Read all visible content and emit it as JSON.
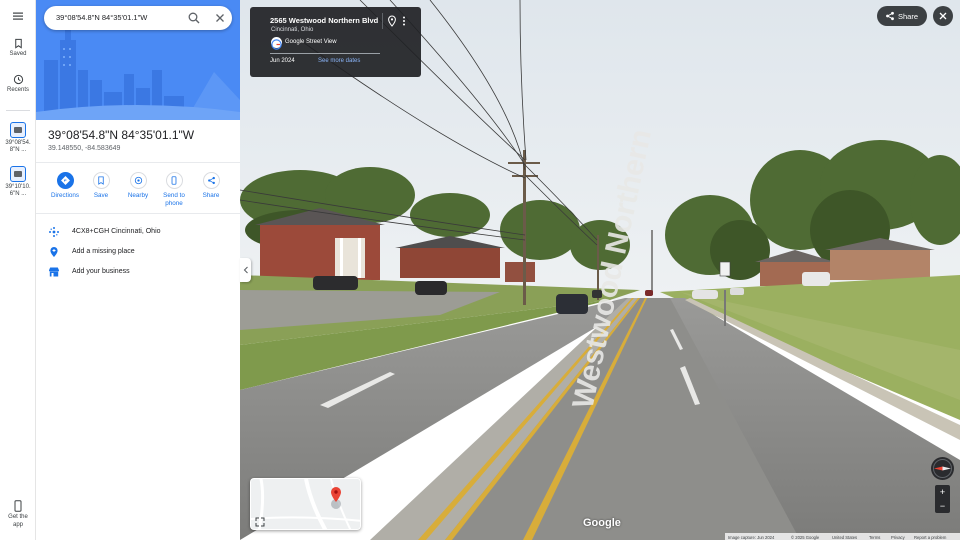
{
  "rail": {
    "saved_label": "Saved",
    "recents_label": "Recents",
    "recent_items": [
      {
        "label_line1": "39°08'54.",
        "label_line2": "8\"N ..."
      },
      {
        "label_line1": "39°10'10.",
        "label_line2": "6\"N ..."
      }
    ],
    "get_app_line1": "Get the",
    "get_app_line2": "app"
  },
  "search": {
    "value": "39°08'54.8\"N 84°35'01.1\"W"
  },
  "place": {
    "title": "39°08'54.8\"N 84°35'01.1\"W",
    "decimal_coords": "39.148550, -84.583649"
  },
  "actions": [
    {
      "label_line1": "Directions",
      "label_line2": "",
      "icon": "directions-icon"
    },
    {
      "label_line1": "Save",
      "label_line2": "",
      "icon": "bookmark-icon"
    },
    {
      "label_line1": "Nearby",
      "label_line2": "",
      "icon": "nearby-icon"
    },
    {
      "label_line1": "Send to",
      "label_line2": "phone",
      "icon": "phone-icon"
    },
    {
      "label_line1": "Share",
      "label_line2": "",
      "icon": "share-icon"
    }
  ],
  "info_rows": [
    {
      "text": "4CX8+CGH Cincinnati, Ohio",
      "icon": "plus-code-icon"
    },
    {
      "text": "Add a missing place",
      "icon": "add-place-icon"
    },
    {
      "text": "Add your business",
      "icon": "business-icon"
    }
  ],
  "streetview_card": {
    "address": "2565 Westwood Northern Blvd",
    "city": "Cincinnati, Ohio",
    "source": "Google Street View",
    "date": "Jun 2024",
    "see_more": "See more dates"
  },
  "top_buttons": {
    "share_label": "Share"
  },
  "zoom": {
    "in": "+",
    "out": "−"
  },
  "watermark": "Google",
  "footer": {
    "capture": "Image capture: Jun 2024",
    "copyright": "© 2025 Google",
    "region": "United States",
    "terms": "Terms",
    "privacy": "Privacy",
    "report": "Report a problem"
  },
  "street_sign_text": "Westwood Northern",
  "colors": {
    "accent": "#1a73e8",
    "hero_blue": "#4a8af4",
    "dark_chip": "#3c4043",
    "sky": "#e6ecf1",
    "grass": "#8da25a",
    "road": "#8a8a88",
    "center_line": "#e0b33a"
  }
}
